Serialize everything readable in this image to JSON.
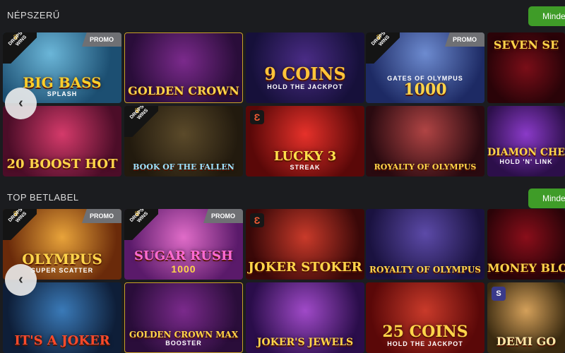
{
  "sections": [
    {
      "title": "NÉPSZERŰ",
      "all_label": "Minden",
      "tiles": [
        {
          "name": "Big Bass Splash",
          "art": "BIG BASS",
          "sub": "SPLASH",
          "promo": "PROMO",
          "badge": "DROPS & WINS"
        },
        {
          "name": "Golden Crown",
          "art": "GOLDEN CROWN",
          "sub": ""
        },
        {
          "name": "9 Coins",
          "art": "9 COINS",
          "sub": "HOLD THE JACKPOT"
        },
        {
          "name": "Gates of Olympus 1000",
          "art": "1000",
          "sub": "GATES OF OLYMPUS",
          "promo": "PROMO",
          "badge": "DROPS & WINS"
        },
        {
          "name": "Seven Sevens",
          "art": "SEVEN SE",
          "sub": ""
        },
        {
          "name": "20 Boost Hot",
          "art": "20 BOOST HOT",
          "sub": ""
        },
        {
          "name": "Book of the Fallen",
          "art": "BOOK OF THE FALLEN",
          "sub": "",
          "badge": "DROPS & WINS"
        },
        {
          "name": "Lucky Streak 3",
          "art": "LUCKY 3",
          "sub": "STREAK"
        },
        {
          "name": "Royalty of Olympus",
          "art": "ROYALTY OF OLYMPUS",
          "sub": ""
        },
        {
          "name": "Diamond Chest",
          "art": "DIAMON CHEST",
          "sub": "HOLD 'N' LINK"
        }
      ]
    },
    {
      "title": "TOP BETLABEL",
      "all_label": "Minden",
      "tiles": [
        {
          "name": "Gates of Olympus Super Scatter",
          "art": "OLYMPUS",
          "sub": "SUPER SCATTER",
          "promo": "PROMO",
          "badge": "DROPS & WINS"
        },
        {
          "name": "Sugar Rush 1000",
          "art": "SUGAR RUSH",
          "sub": "1000",
          "promo": "PROMO",
          "badge": "DROPS & WINS"
        },
        {
          "name": "Joker Stoker",
          "art": "JOKER STOKER",
          "sub": ""
        },
        {
          "name": "Royalty of Olympus",
          "art": "ROYALTY OF OLYMPUS",
          "sub": ""
        },
        {
          "name": "Seven Money Bloxx",
          "art": "MONEY BLOXX",
          "sub": ""
        },
        {
          "name": "It's a Joker",
          "art": "IT'S A JOKER",
          "sub": ""
        },
        {
          "name": "Golden Crown Max Booster",
          "art": "GOLDEN CROWN MAX",
          "sub": "BOOSTER"
        },
        {
          "name": "Joker's Jewels",
          "art": "JOKER'S JEWELS",
          "sub": ""
        },
        {
          "name": "25 Coins",
          "art": "25 COINS",
          "sub": "HOLD THE JACKPOT"
        },
        {
          "name": "Demi Gods",
          "art": "DEMI GO",
          "sub": ""
        }
      ]
    }
  ],
  "nav": {
    "prev_icon": "‹"
  },
  "provider_icon": "Ɛ",
  "colors": {
    "accent": "#3f9c28",
    "background": "#1b1c1f",
    "promo": "#6f7074"
  }
}
